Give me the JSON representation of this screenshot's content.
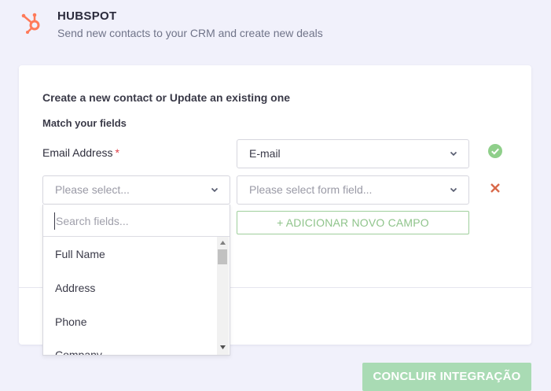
{
  "header": {
    "title": "HUBSPOT",
    "subtitle": "Send new contacts to your CRM and create new deals",
    "logo_icon": "hubspot-sprocket-icon",
    "logo_color": "#ff7a59"
  },
  "card": {
    "section_title": "Create a new contact or Update an existing one",
    "match_title": "Match your fields",
    "rows": [
      {
        "label": "Email Address",
        "required_mark": "*",
        "mapped_value": "E-mail",
        "status_icon": "check-circle-icon",
        "status_color": "#8fcf8a"
      },
      {
        "crm_placeholder": "Please select...",
        "form_placeholder": "Please select form field...",
        "status_icon": "remove-x-icon",
        "status_color": "#d9694a"
      }
    ],
    "add_field_label": "+ ADICIONAR NOVO CAMPO"
  },
  "dropdown": {
    "search_placeholder": "Search fields...",
    "options": [
      "Full Name",
      "Address",
      "Phone",
      "Company"
    ]
  },
  "footer": {
    "finish_label": "CONCLUIR INTEGRAÇÃO"
  }
}
